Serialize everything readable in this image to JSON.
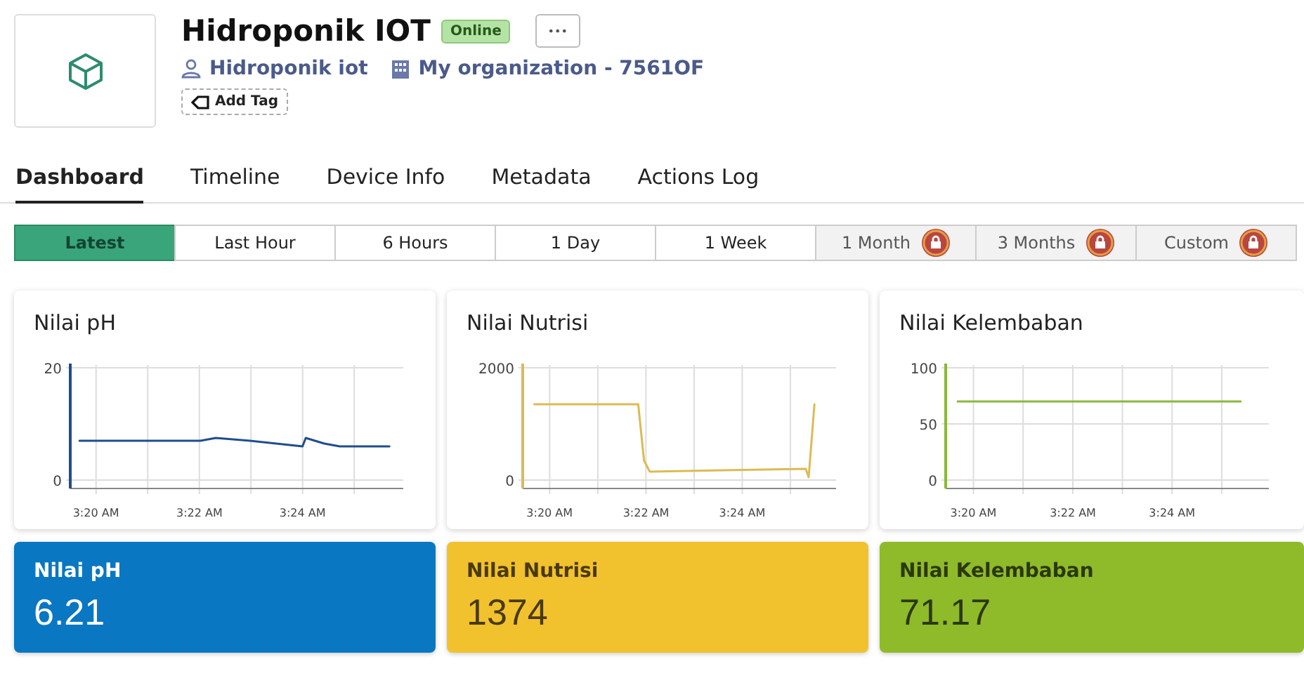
{
  "device": {
    "title": "Hidroponik IOT",
    "status": "Online",
    "more": "•••",
    "owner": "Hidroponik iot",
    "organization": "My organization - 7561OF",
    "add_tag": "Add Tag"
  },
  "tabs": [
    {
      "label": "Dashboard",
      "selected": true
    },
    {
      "label": "Timeline",
      "selected": false
    },
    {
      "label": "Device Info",
      "selected": false
    },
    {
      "label": "Metadata",
      "selected": false
    },
    {
      "label": "Actions Log",
      "selected": false
    }
  ],
  "ranges": [
    {
      "label": "Latest",
      "selected": true,
      "locked": false
    },
    {
      "label": "Last Hour",
      "selected": false,
      "locked": false
    },
    {
      "label": "6 Hours",
      "selected": false,
      "locked": false
    },
    {
      "label": "1 Day",
      "selected": false,
      "locked": false
    },
    {
      "label": "1 Week",
      "selected": false,
      "locked": false
    },
    {
      "label": "1 Month",
      "selected": false,
      "locked": true
    },
    {
      "label": "3 Months",
      "selected": false,
      "locked": true
    },
    {
      "label": "Custom",
      "selected": false,
      "locked": true
    }
  ],
  "charts": [
    {
      "chart_data": {
        "type": "line",
        "title": "Nilai pH",
        "grid": true,
        "x": [
          3.328,
          3.342,
          3.358,
          3.367,
          3.372,
          3.383,
          3.4,
          3.401,
          3.407,
          3.412,
          3.428
        ],
        "series": [
          {
            "color": "#1f4e8c",
            "values": [
              7,
              7,
              7,
              7,
              7.5,
              7,
              6,
              7.5,
              6.5,
              6,
              6
            ]
          }
        ],
        "xlim": [
          3.325,
          3.4325
        ],
        "ylim": [
          0,
          20
        ],
        "xticks": [
          {
            "value": 3.3333,
            "label": "3:20 AM"
          },
          {
            "value": 3.3667,
            "label": "3:22 AM"
          },
          {
            "value": 3.4,
            "label": "3:24 AM"
          }
        ],
        "yticks": [
          0,
          20
        ]
      }
    },
    {
      "chart_data": {
        "type": "line",
        "title": "Nilai Nutrisi",
        "grid": true,
        "x": [
          3.328,
          3.364,
          3.366,
          3.368,
          3.422,
          3.423,
          3.425
        ],
        "series": [
          {
            "color": "#dcbb55",
            "values": [
              1350,
              1350,
              350,
              150,
              200,
              50,
              1350
            ]
          }
        ],
        "xlim": [
          3.324,
          3.4325
        ],
        "ylim": [
          0,
          2000
        ],
        "xticks": [
          {
            "value": 3.3333,
            "label": "3:20 AM"
          },
          {
            "value": 3.3667,
            "label": "3:22 AM"
          },
          {
            "value": 3.4,
            "label": "3:24 AM"
          }
        ],
        "yticks": [
          0,
          2000
        ]
      }
    },
    {
      "chart_data": {
        "type": "line",
        "title": "Nilai Kelembaban",
        "grid": true,
        "x": [
          3.328,
          3.423
        ],
        "series": [
          {
            "color": "#8ab83a",
            "values": [
              70,
              70
            ]
          }
        ],
        "xlim": [
          3.324,
          3.4325
        ],
        "ylim": [
          0,
          100
        ],
        "xticks": [
          {
            "value": 3.3333,
            "label": "3:20 AM"
          },
          {
            "value": 3.3667,
            "label": "3:22 AM"
          },
          {
            "value": 3.4,
            "label": "3:24 AM"
          }
        ],
        "yticks": [
          0,
          50,
          100
        ]
      }
    }
  ],
  "values": [
    {
      "label": "Nilai pH",
      "value": "6.21",
      "color": "#0a77c2"
    },
    {
      "label": "Nilai Nutrisi",
      "value": "1374",
      "color": "#f2c12e"
    },
    {
      "label": "Nilai Kelembaban",
      "value": "71.17",
      "color": "#8fba2a"
    }
  ]
}
